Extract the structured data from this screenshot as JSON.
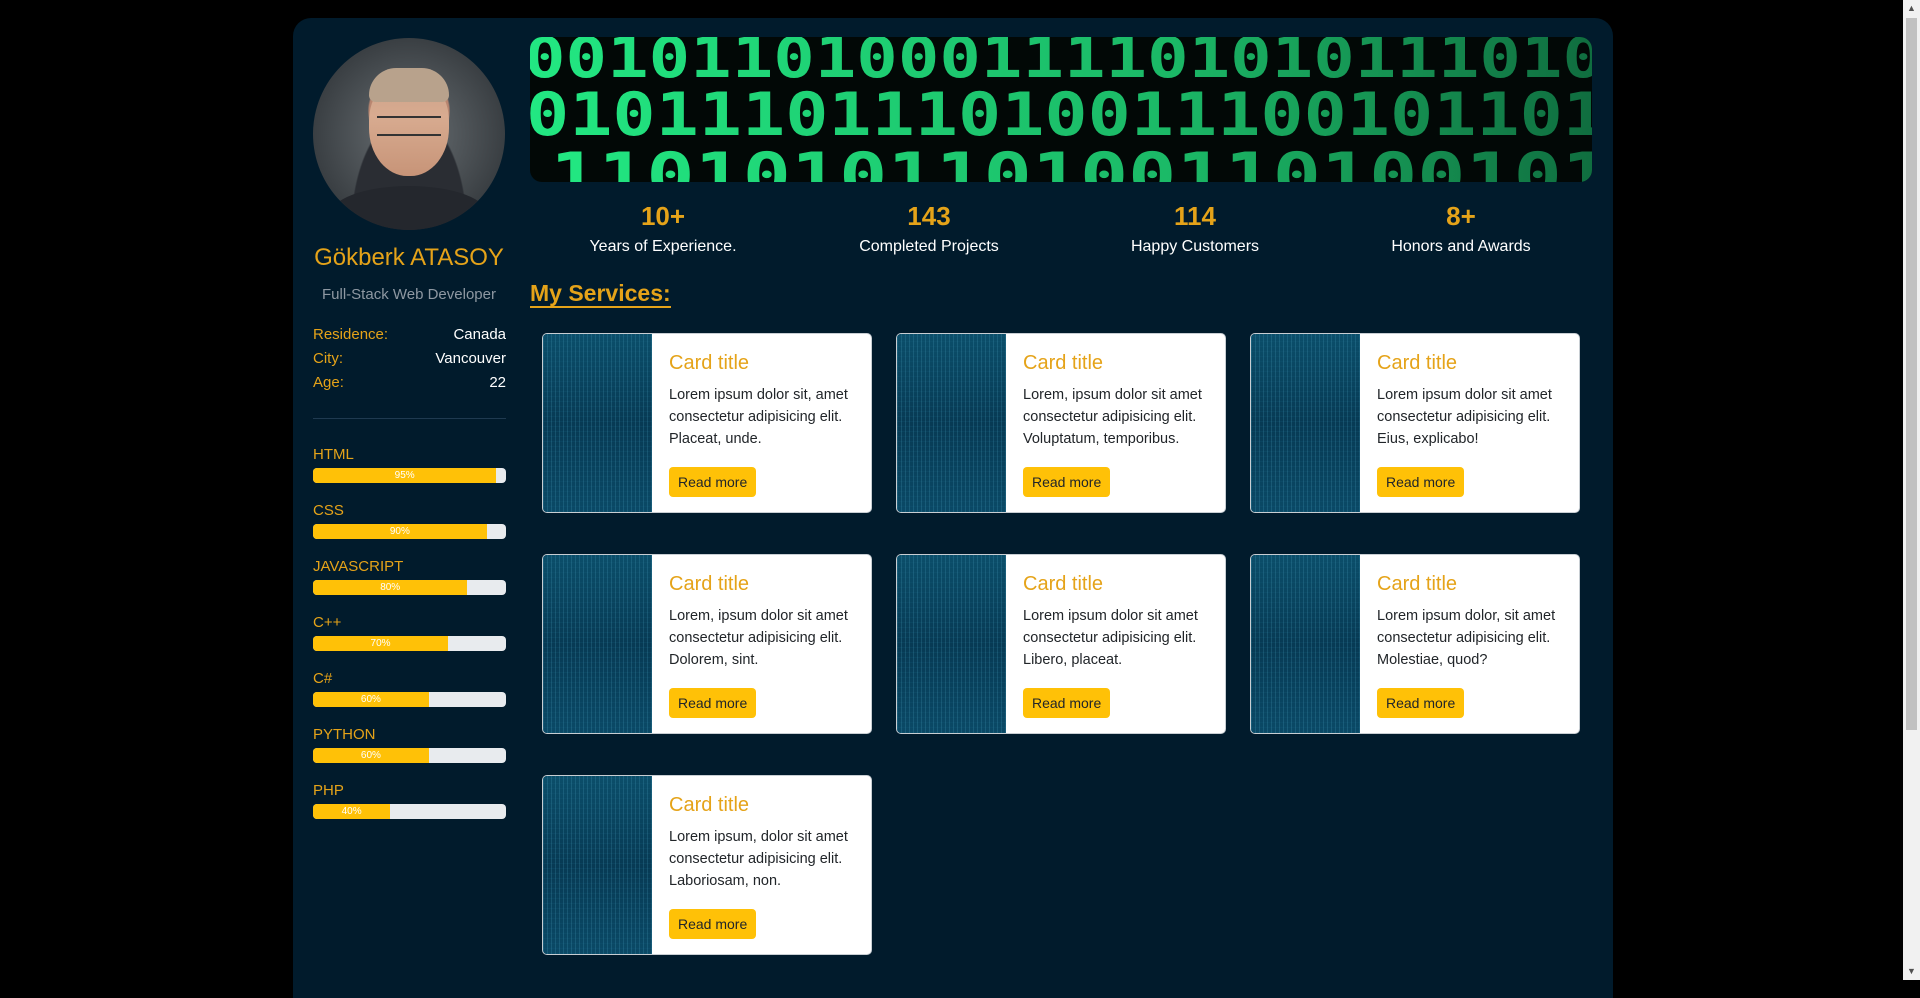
{
  "profile": {
    "name": "Gökberk ATASOY",
    "role": "Full-Stack Web Developer",
    "info": [
      {
        "key": "Residence:",
        "value": "Canada"
      },
      {
        "key": "City:",
        "value": "Vancouver"
      },
      {
        "key": "Age:",
        "value": "22"
      }
    ]
  },
  "skills": [
    {
      "name": "HTML",
      "percent_label": "95%",
      "percent": 95
    },
    {
      "name": "CSS",
      "percent_label": "90%",
      "percent": 90
    },
    {
      "name": "JAVASCRIPT",
      "percent_label": "80%",
      "percent": 80
    },
    {
      "name": "C++",
      "percent_label": "70%",
      "percent": 70
    },
    {
      "name": "C#",
      "percent_label": "60%",
      "percent": 60
    },
    {
      "name": "PYTHON",
      "percent_label": "60%",
      "percent": 60
    },
    {
      "name": "PHP",
      "percent_label": "40%",
      "percent": 40
    }
  ],
  "stats": [
    {
      "number": "10+",
      "label": "Years of Experience."
    },
    {
      "number": "143",
      "label": "Completed Projects"
    },
    {
      "number": "114",
      "label": "Happy Customers"
    },
    {
      "number": "8+",
      "label": "Honors and Awards"
    }
  ],
  "services": {
    "title": "My Services:",
    "cards": [
      {
        "title": "Card title",
        "text": "Lorem ipsum dolor sit, amet consectetur adipisicing elit. Placeat, unde.",
        "button": "Read more"
      },
      {
        "title": "Card title",
        "text": "Lorem, ipsum dolor sit amet consectetur adipisicing elit. Voluptatum, temporibus.",
        "button": "Read more"
      },
      {
        "title": "Card title",
        "text": "Lorem ipsum dolor sit amet consectetur adipisicing elit. Eius, explicabo!",
        "button": "Read more"
      },
      {
        "title": "Card title",
        "text": "Lorem, ipsum dolor sit amet consectetur adipisicing elit. Dolorem, sint.",
        "button": "Read more"
      },
      {
        "title": "Card title",
        "text": "Lorem ipsum dolor sit amet consectetur adipisicing elit. Libero, placeat.",
        "button": "Read more"
      },
      {
        "title": "Card title",
        "text": "Lorem ipsum dolor, sit amet consectetur adipisicing elit. Molestiae, quod?",
        "button": "Read more"
      },
      {
        "title": "Card title",
        "text": "Lorem ipsum, dolor sit amet consectetur adipisicing elit. Laboriosam, non.",
        "button": "Read more"
      }
    ]
  },
  "colors": {
    "background": "#000000",
    "panel": "#011b2c",
    "accent": "#e5a319",
    "button": "#ffc107",
    "banner_digits": "#1fd679"
  },
  "icons": {
    "scroll_up": "scroll-up-arrow-icon",
    "scroll_down": "scroll-down-arrow-icon"
  }
}
